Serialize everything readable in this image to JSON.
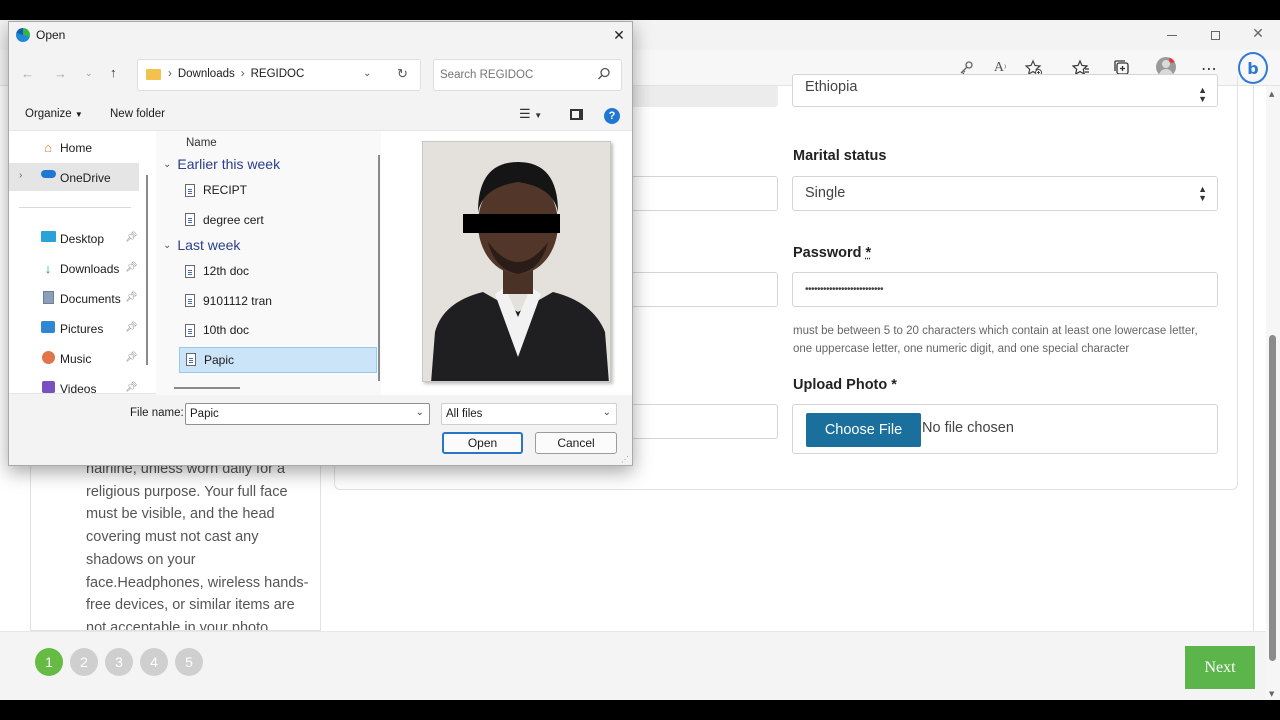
{
  "browser": {
    "toolbar_icons": [
      "key-icon",
      "read-aloud-icon",
      "add-favorite-icon",
      "favorites-icon",
      "collections-icon",
      "profile-icon",
      "more-icon",
      "bing-icon"
    ]
  },
  "form": {
    "country_value": "Ethiopia",
    "marital_label": "Marital status",
    "marital_value": "Single",
    "password_label": "Password",
    "password_required_mark": "*",
    "password_value": "••••••••••••••••••••••••••",
    "password_hint": "must be between 5 to 20 characters which contain at least one lowercase letter, one uppercase letter, one numeric digit, and one special character",
    "upload_label": "Upload Photo *",
    "choose_file_label": "Choose File",
    "no_file_label": "No file chosen"
  },
  "instructions": {
    "text": "hairline, unless worn daily for a religious purpose. Your full face must be visible, and the head covering must not cast any shadows on your face.Headphones, wireless hands-free devices, or similar items are not acceptable in your photo."
  },
  "steps": [
    "1",
    "2",
    "3",
    "4",
    "5"
  ],
  "active_step": 1,
  "next_label": "Next",
  "dialog": {
    "title": "Open",
    "path": [
      "Downloads",
      "REGIDOC"
    ],
    "search_placeholder": "Search REGIDOC",
    "organize_label": "Organize",
    "new_folder_label": "New folder",
    "nav_items": [
      {
        "label": "Home",
        "icon": "home-icon",
        "pinned": false
      },
      {
        "label": "OneDrive",
        "icon": "onedrive-icon",
        "pinned": false
      },
      {
        "label": "Desktop",
        "icon": "desktop-icon",
        "pinned": true
      },
      {
        "label": "Downloads",
        "icon": "downloads-icon",
        "pinned": true
      },
      {
        "label": "Documents",
        "icon": "documents-icon",
        "pinned": true
      },
      {
        "label": "Pictures",
        "icon": "pictures-icon",
        "pinned": true
      },
      {
        "label": "Music",
        "icon": "music-icon",
        "pinned": true
      },
      {
        "label": "Videos",
        "icon": "videos-icon",
        "pinned": true
      }
    ],
    "column_name": "Name",
    "groups": [
      {
        "label": "Earlier this week",
        "files": [
          "RECIPT",
          "degree cert"
        ]
      },
      {
        "label": "Last week",
        "files": [
          "12th doc",
          "9101112 tran",
          "10th doc",
          "Papic"
        ]
      }
    ],
    "selected_file": "Papic",
    "file_name_label": "File name:",
    "file_name_value": "Papic",
    "filter_value": "All files",
    "open_label": "Open",
    "cancel_label": "Cancel"
  }
}
